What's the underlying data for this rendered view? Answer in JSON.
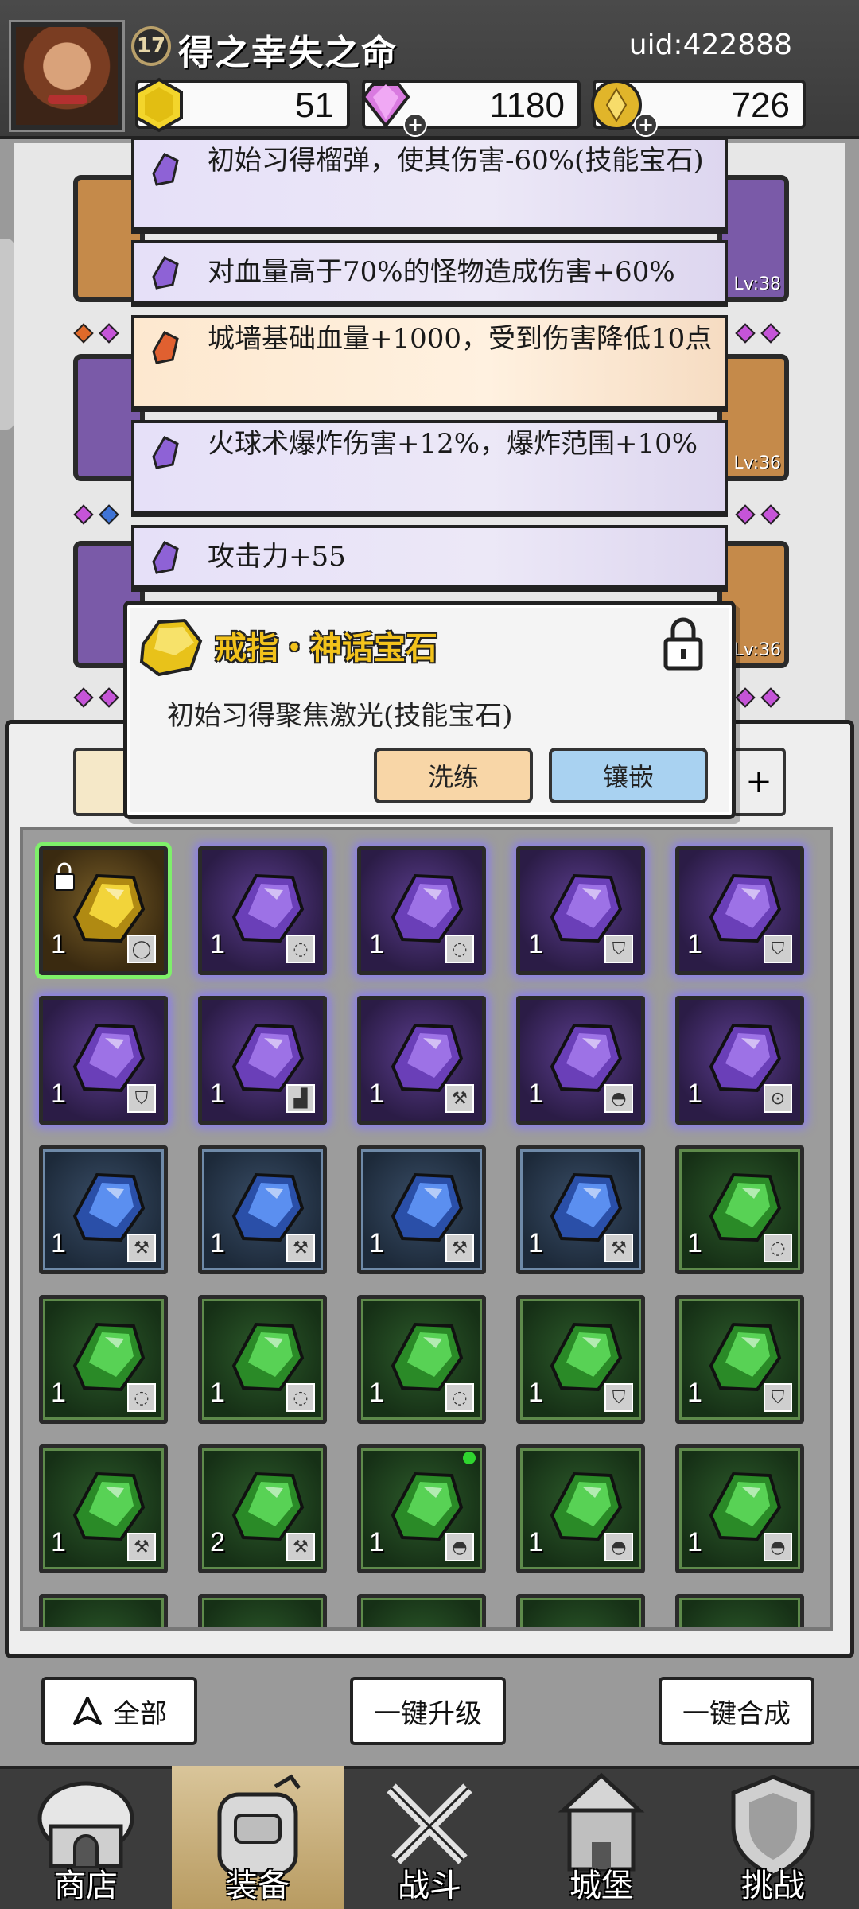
{
  "header": {
    "level": "17",
    "player_name": "得之幸失之命",
    "uid": "uid:422888",
    "resources": {
      "gold_gem": "51",
      "diamond": "1180",
      "coin": "726"
    }
  },
  "equipment_levels": [
    "Lv:38",
    "Lv:36",
    "Lv:36"
  ],
  "stats": [
    {
      "text": "初始习得榴弹，使其伤害-60%(技能宝石)",
      "color": "purple"
    },
    {
      "text": "对血量高于70%的怪物造成伤害+60%",
      "color": "purple"
    },
    {
      "text": "城墙基础血量+1000，受到伤害降低10点",
      "color": "orange"
    },
    {
      "text": "火球术爆炸伤害+12%，爆炸范围+10%",
      "color": "purple"
    },
    {
      "text": "攻击力+55",
      "color": "purple"
    }
  ],
  "popup": {
    "title": "戒指・神话宝石",
    "description": "初始习得聚焦激光(技能宝石)",
    "refine_label": "洗练",
    "inlay_label": "镶嵌"
  },
  "inventory": [
    [
      {
        "rarity": "gold",
        "count": "1",
        "part": "ring",
        "locked": true
      },
      {
        "rarity": "purple",
        "count": "1",
        "part": "necklace"
      },
      {
        "rarity": "purple",
        "count": "1",
        "part": "necklace"
      },
      {
        "rarity": "purple",
        "count": "1",
        "part": "armor"
      },
      {
        "rarity": "purple",
        "count": "1",
        "part": "armor"
      }
    ],
    [
      {
        "rarity": "purple",
        "count": "1",
        "part": "armor"
      },
      {
        "rarity": "purple",
        "count": "1",
        "part": "boots"
      },
      {
        "rarity": "purple",
        "count": "1",
        "part": "weapon"
      },
      {
        "rarity": "purple",
        "count": "1",
        "part": "helmet"
      },
      {
        "rarity": "purple",
        "count": "1",
        "part": "amulet"
      }
    ],
    [
      {
        "rarity": "blue",
        "count": "1",
        "part": "weapon"
      },
      {
        "rarity": "blue",
        "count": "1",
        "part": "weapon"
      },
      {
        "rarity": "blue",
        "count": "1",
        "part": "weapon"
      },
      {
        "rarity": "blue",
        "count": "1",
        "part": "weapon"
      },
      {
        "rarity": "green",
        "count": "1",
        "part": "necklace"
      }
    ],
    [
      {
        "rarity": "green",
        "count": "1",
        "part": "necklace"
      },
      {
        "rarity": "green",
        "count": "1",
        "part": "necklace"
      },
      {
        "rarity": "green",
        "count": "1",
        "part": "necklace"
      },
      {
        "rarity": "green",
        "count": "1",
        "part": "armor"
      },
      {
        "rarity": "green",
        "count": "1",
        "part": "armor"
      }
    ],
    [
      {
        "rarity": "green",
        "count": "1",
        "part": "weapon"
      },
      {
        "rarity": "green",
        "count": "2",
        "part": "weapon"
      },
      {
        "rarity": "green",
        "count": "1",
        "part": "helmet",
        "new": true
      },
      {
        "rarity": "green",
        "count": "1",
        "part": "helmet"
      },
      {
        "rarity": "green",
        "count": "1",
        "part": "helmet"
      }
    ]
  ],
  "actions": {
    "filter_all": "全部",
    "upgrade_all": "一键升级",
    "merge_all": "一键合成"
  },
  "nav": [
    {
      "label": "商店",
      "icon": "shop-icon"
    },
    {
      "label": "装备",
      "icon": "backpack-icon",
      "active": true
    },
    {
      "label": "战斗",
      "icon": "crossed-swords-icon"
    },
    {
      "label": "城堡",
      "icon": "castle-icon"
    },
    {
      "label": "挑战",
      "icon": "shield-challenge-icon"
    }
  ],
  "colors": {
    "purple_gem": "#8e62d6",
    "blue_gem": "#3f74d6",
    "green_gem": "#3fb83b",
    "gold_gem": "#e8c21a",
    "orange_gem": "#e06030",
    "popup_title": "#f2c21b"
  }
}
